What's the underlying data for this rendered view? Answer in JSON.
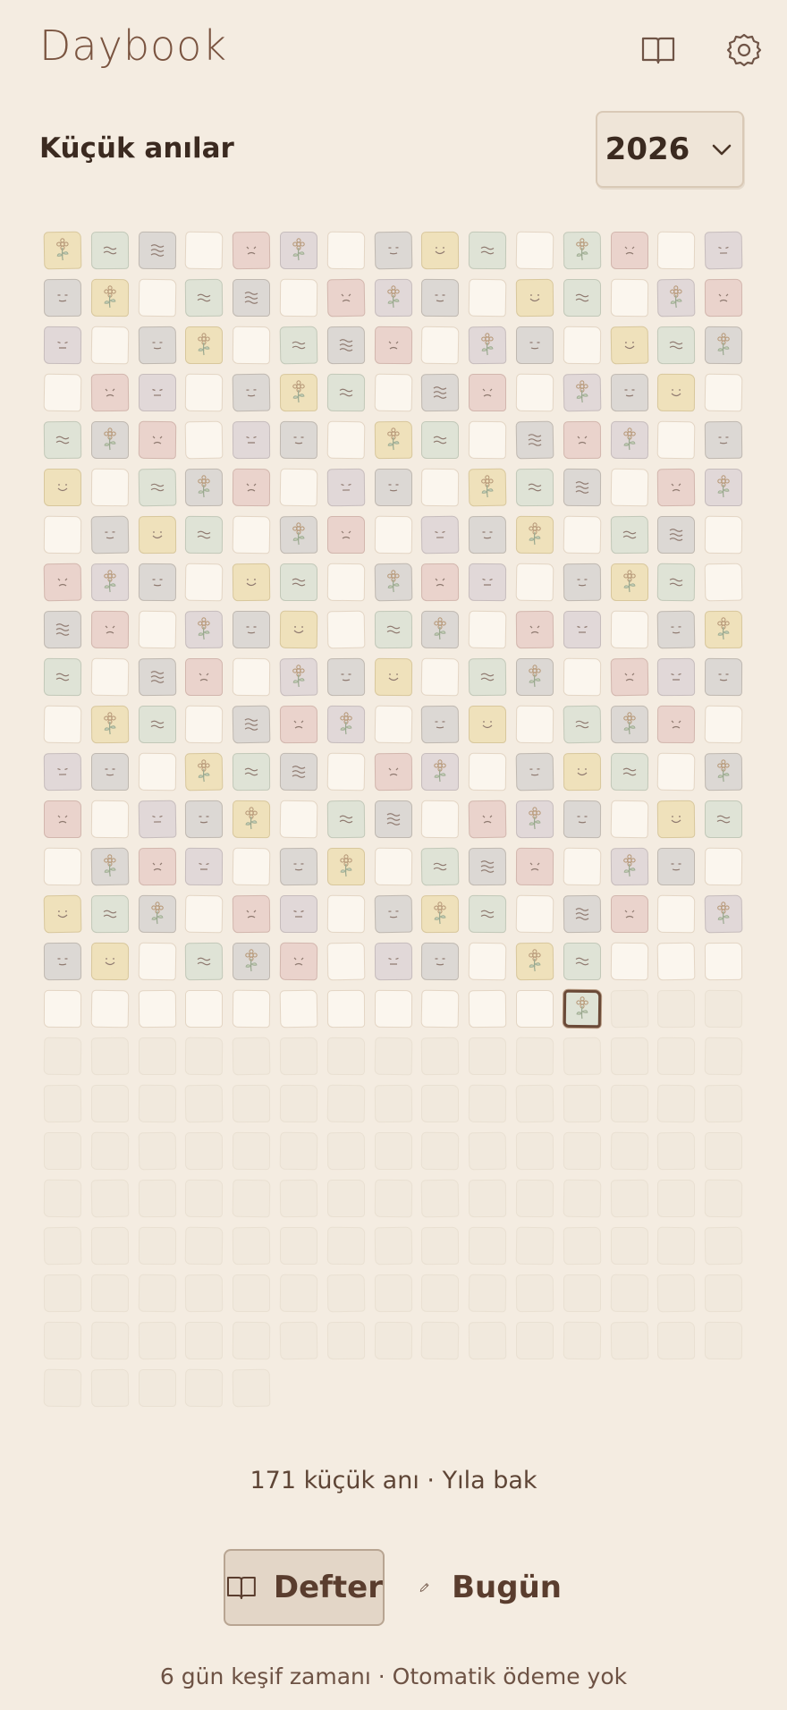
{
  "header": {
    "app_title": "Daybook",
    "journal_icon": "open-book-icon",
    "settings_icon": "gear-icon"
  },
  "section": {
    "title": "Küçük anılar",
    "year_value": "2026",
    "year_chevron_icon": "chevron-down-icon"
  },
  "calendar": {
    "columns": 15,
    "total_days": 365,
    "today_index": 251,
    "day_states": [
      "flower-yellow",
      "calm-sage",
      "calm-grey",
      "empty",
      "soso-rose",
      "flower-lilac",
      "empty",
      "neutral-grey",
      "happy-yellow",
      "calm-sage",
      "empty",
      "flower-sage",
      "soso-rose",
      "empty",
      "meh-lilac",
      "neutral-grey",
      "flower-yellow",
      "empty",
      "calm-sage",
      "calm-grey",
      "empty",
      "soso-rose",
      "flower-lilac",
      "neutral-grey",
      "empty",
      "happy-yellow",
      "calm-sage",
      "empty",
      "flower-lilac",
      "soso-rose",
      "meh-lilac",
      "empty",
      "neutral-grey",
      "flower-yellow",
      "empty",
      "calm-sage",
      "calm-grey",
      "soso-rose",
      "empty",
      "flower-lilac",
      "neutral-grey",
      "empty",
      "happy-yellow",
      "calm-sage",
      "flower-grey",
      "empty",
      "soso-rose",
      "meh-lilac",
      "empty",
      "neutral-grey",
      "flower-yellow",
      "calm-sage",
      "empty",
      "calm-grey",
      "soso-rose",
      "empty",
      "flower-lilac",
      "neutral-grey",
      "happy-yellow",
      "empty",
      "calm-sage",
      "flower-grey",
      "soso-rose",
      "empty",
      "meh-lilac",
      "neutral-grey",
      "empty",
      "flower-yellow",
      "calm-sage",
      "empty",
      "calm-grey",
      "soso-rose",
      "flower-lilac",
      "empty",
      "neutral-grey",
      "happy-yellow",
      "empty",
      "calm-sage",
      "flower-grey",
      "soso-rose",
      "empty",
      "meh-lilac",
      "neutral-grey",
      "empty",
      "flower-yellow",
      "calm-sage",
      "calm-grey",
      "empty",
      "soso-rose",
      "flower-lilac",
      "empty",
      "neutral-grey",
      "happy-yellow",
      "calm-sage",
      "empty",
      "flower-grey",
      "soso-rose",
      "empty",
      "meh-lilac",
      "neutral-grey",
      "flower-yellow",
      "empty",
      "calm-sage",
      "calm-grey",
      "empty",
      "soso-rose",
      "flower-lilac",
      "neutral-grey",
      "empty",
      "happy-yellow",
      "calm-sage",
      "empty",
      "flower-grey",
      "soso-rose",
      "meh-lilac",
      "empty",
      "neutral-grey",
      "flower-yellow",
      "calm-sage",
      "empty",
      "calm-grey",
      "soso-rose",
      "empty",
      "flower-lilac",
      "neutral-grey",
      "happy-yellow",
      "empty",
      "calm-sage",
      "flower-grey",
      "empty",
      "soso-rose",
      "meh-lilac",
      "empty",
      "neutral-grey",
      "flower-yellow",
      "calm-sage",
      "empty",
      "calm-grey",
      "soso-rose",
      "empty",
      "flower-lilac",
      "neutral-grey",
      "happy-yellow",
      "empty",
      "calm-sage",
      "flower-grey",
      "empty",
      "soso-rose",
      "meh-lilac",
      "neutral-grey",
      "empty",
      "flower-yellow",
      "calm-sage",
      "empty",
      "calm-grey",
      "soso-rose",
      "flower-lilac",
      "empty",
      "neutral-grey",
      "happy-yellow",
      "empty",
      "calm-sage",
      "flower-grey",
      "soso-rose",
      "empty",
      "meh-lilac",
      "neutral-grey",
      "empty",
      "flower-yellow",
      "calm-sage",
      "calm-grey",
      "empty",
      "soso-rose",
      "flower-lilac",
      "empty",
      "neutral-grey",
      "happy-yellow",
      "calm-sage",
      "empty",
      "flower-grey",
      "soso-rose",
      "empty",
      "meh-lilac",
      "neutral-grey",
      "flower-yellow",
      "empty",
      "calm-sage",
      "calm-grey",
      "empty",
      "soso-rose",
      "flower-lilac",
      "neutral-grey",
      "empty",
      "happy-yellow",
      "calm-sage",
      "empty",
      "flower-grey",
      "soso-rose",
      "meh-lilac",
      "empty",
      "neutral-grey",
      "flower-yellow",
      "empty",
      "calm-sage",
      "calm-grey",
      "soso-rose",
      "empty",
      "flower-lilac",
      "neutral-grey",
      "empty",
      "happy-yellow",
      "calm-sage",
      "flower-grey",
      "empty",
      "soso-rose",
      "meh-lilac",
      "empty",
      "neutral-grey",
      "flower-yellow",
      "calm-sage",
      "empty",
      "calm-grey",
      "soso-rose",
      "empty",
      "flower-lilac",
      "neutral-grey",
      "happy-yellow",
      "empty",
      "calm-sage",
      "flower-grey",
      "soso-rose",
      "empty",
      "meh-lilac",
      "neutral-grey",
      "empty",
      "flower-yellow",
      "calm-sage",
      "empty",
      "empty",
      "empty",
      "empty",
      "empty",
      "empty",
      "empty",
      "empty",
      "empty",
      "empty",
      "empty",
      "empty",
      "empty",
      "empty",
      "flower-sage"
    ]
  },
  "summary": {
    "text": "171 küçük anı · Yıla bak"
  },
  "bottom_nav": {
    "journal_label": "Defter",
    "journal_icon": "open-book-icon",
    "today_label": "Bugün",
    "today_icon": "pencil-icon"
  },
  "footer": {
    "note": "6 gün keşif zamanı · Otomatik ödeme yok"
  },
  "palette": {
    "background": "#f4ece1",
    "yellow": "#efe1bb",
    "sage": "#dfe3d6",
    "grey": "#dcd8d4",
    "rose": "#ead3cc",
    "lilac": "#e1d8d8",
    "empty": "#fbf6ee",
    "accent": "#6a4a38"
  }
}
